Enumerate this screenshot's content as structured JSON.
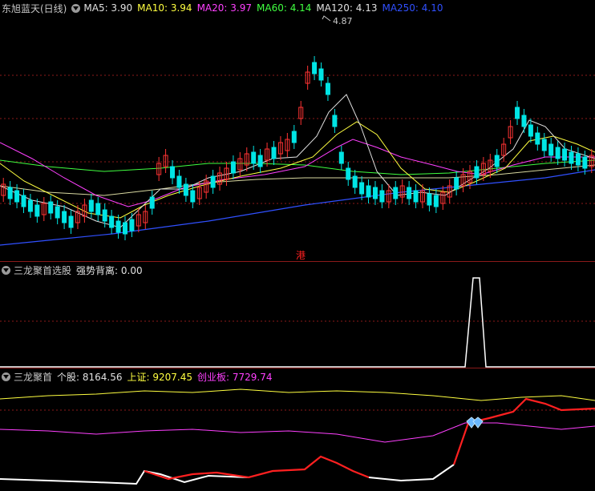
{
  "main": {
    "title": "东旭蓝天(日线)",
    "title_color": "#c8c8c8",
    "legend": [
      {
        "label": "MA5: 3.90",
        "color": "#e0e0e0"
      },
      {
        "label": "MA10: 3.94",
        "color": "#ffff40"
      },
      {
        "label": "MA20: 3.97",
        "color": "#ff40ff"
      },
      {
        "label": "MA60: 4.14",
        "color": "#40ff40"
      },
      {
        "label": "MA120: 4.13",
        "color": "#e0e0e0"
      },
      {
        "label": "MA250: 4.10",
        "color": "#3050ff"
      }
    ],
    "high_label": "4.87",
    "hk_tag": "港",
    "toggle_icon": "chevron-down-icon"
  },
  "sub1": {
    "title": "三龙聚首选股",
    "legend": [
      {
        "label": "强势背离: 0.00",
        "color": "#e0e0e0"
      }
    ]
  },
  "sub2": {
    "title": "三龙聚首",
    "legend": [
      {
        "label": "个股: 8164.56",
        "color": "#e0e0e0"
      },
      {
        "label": "上证: 9207.45",
        "color": "#ffff40"
      },
      {
        "label": "创业板: 7729.74",
        "color": "#ff40ff"
      }
    ],
    "signal_icon": "diamond-icon"
  },
  "colors": {
    "up": "#ff3333",
    "down": "#00e5e5",
    "grid": "#8b1a1a",
    "divider": "#8b1a1a"
  }
}
